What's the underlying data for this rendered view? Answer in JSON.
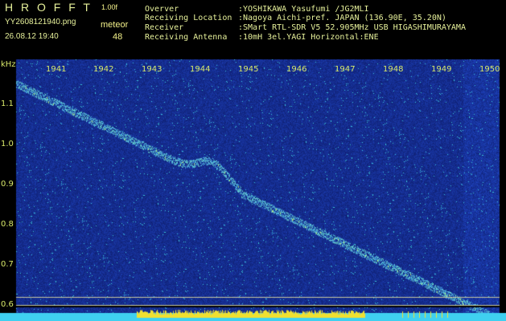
{
  "app": {
    "logo": "H R O F F T",
    "version": "1.00f",
    "filename": "YY2608121940.png",
    "datetime": "26.08.12 19:40",
    "meteor_label": "meteor",
    "meteor_count": "48"
  },
  "info": [
    {
      "label": "Overver",
      "value": ":YOSHIKAWA Yasufumi /JG2MLI"
    },
    {
      "label": "Receiving Location",
      "value": ":Nagoya Aichi-pref. JAPAN (136.90E, 35.20N)"
    },
    {
      "label": "Receiver",
      "value": ":SMart RTL-SDR V5 52.905MHz USB HIGASHIMURAYAMA"
    },
    {
      "label": "Receiving Antenna",
      "value": ":10mH 3el.YAGI Horizontal:ENE"
    }
  ],
  "axes": {
    "khz_label": "kHz",
    "years": [
      "1941",
      "1942",
      "1943",
      "1944",
      "1945",
      "1946",
      "1947",
      "1948",
      "1949",
      "1950"
    ],
    "khz_ticks": [
      "1.1",
      "1.0",
      "0.9",
      "0.8",
      "0.7",
      "0.6"
    ]
  },
  "colors": {
    "background": "#000000",
    "header_text": "#e6f09a",
    "tick_text": "#d8e86a",
    "spectrogram_base": "#1a2a7a",
    "signal_trace": "#6fe0d0",
    "bottom_band": "#3fd0f0",
    "meteor_bars": "#f0e030"
  }
}
